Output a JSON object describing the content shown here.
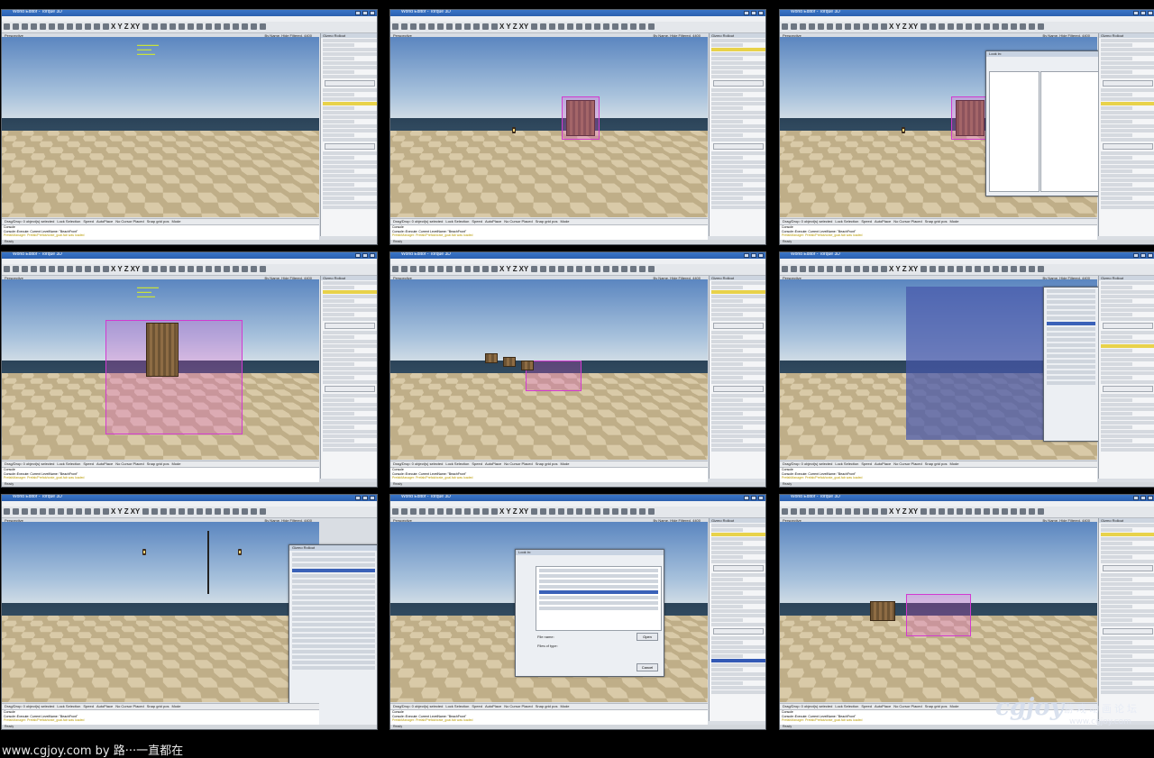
{
  "window": {
    "title": "World Editor - Torque 3D",
    "menu": [
      "File",
      "Edit",
      "Modify",
      "Display",
      "Config Spec",
      "Group",
      "Prefabs",
      "Terrain",
      "Sound",
      "Game",
      "AI",
      "Clouds",
      "Tools",
      "View",
      "Help"
    ],
    "axes": [
      "X",
      "Y",
      "Z",
      "XY"
    ]
  },
  "viewport": {
    "label": "Perspective",
    "info": "By Name, Hide Filtered, 4400"
  },
  "side_panel": {
    "title": "Gizmo Rollout"
  },
  "status": {
    "left": "Drag/Drop: 0 object(s) selected",
    "lock": "Lock Selection",
    "speed": "Speed",
    "autoplace": "AutoPlace",
    "cursor": "No Cursor Placed",
    "snap": "Snap grid pos",
    "mode": "Mode"
  },
  "console": {
    "title": "Console",
    "line1": "Console::Execute: Current LevelName: \"BeachFront\"",
    "line2": "PrefabManager: Prefab/Prefab/crate_goal.fab was loaded"
  },
  "bottom_bar": {
    "text": "Ready"
  },
  "dialogs": {
    "open_label": "Open",
    "cancel_label": "Cancel",
    "file_name": "File name:",
    "files_of_type": "Files of type:",
    "look_in": "Look in:",
    "folder": "fishing_crates"
  },
  "watermark": {
    "chinese": "游戏动画论坛",
    "logo": "cgjoy",
    "url": "www.cgjoy.com"
  },
  "credit": "www.cgjoy.com by 路···一直都在"
}
